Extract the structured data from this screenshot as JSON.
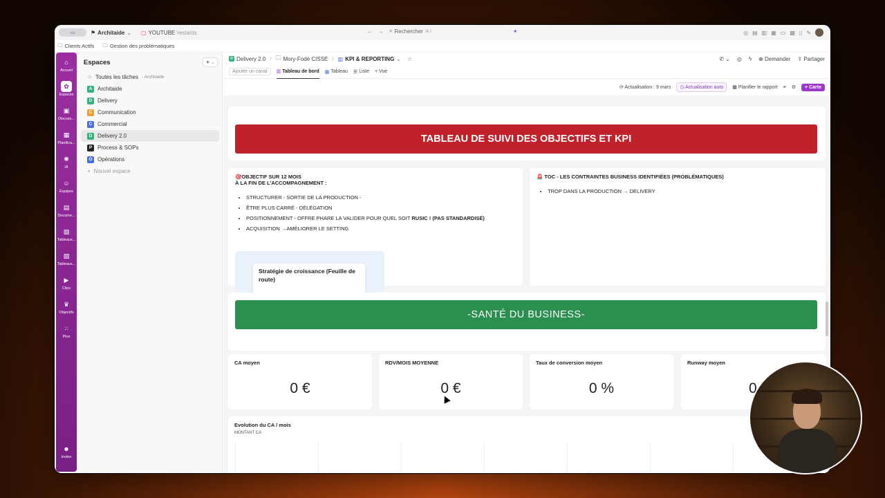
{
  "titlebar": {
    "workspace": "Architaide",
    "tab_label": "YOUTUBE",
    "tab_suffix": "restants",
    "search_placeholder": "Rechercher",
    "search_shortcut": "⌘J"
  },
  "bookmarks": [
    {
      "label": "Clients Actifs"
    },
    {
      "label": "Gestion des problématiques"
    }
  ],
  "rail": [
    {
      "label": "Accueil",
      "icon": "home-icon"
    },
    {
      "label": "Espaces",
      "icon": "spaces-icon",
      "active": true
    },
    {
      "label": "Discuss...",
      "icon": "chat-icon"
    },
    {
      "label": "Planifica...",
      "icon": "calendar-icon"
    },
    {
      "label": "IA",
      "icon": "ai-icon"
    },
    {
      "label": "Équipes",
      "icon": "team-icon"
    },
    {
      "label": "Docume...",
      "icon": "document-icon"
    },
    {
      "label": "Tableaux...",
      "icon": "dashboard-icon"
    },
    {
      "label": "Tableaux...",
      "icon": "whiteboard-icon"
    },
    {
      "label": "Clips",
      "icon": "clip-icon"
    },
    {
      "label": "Objectifs",
      "icon": "trophy-icon"
    },
    {
      "label": "Plus",
      "icon": "grid-icon"
    }
  ],
  "rail_bottom": {
    "label": "Inviter"
  },
  "spaces": {
    "title": "Espaces",
    "all_tasks": "Toutes les tâches",
    "all_tasks_sub": "- Architaide",
    "items": [
      {
        "letter": "A",
        "label": "Architaide",
        "color": "#2fb47c"
      },
      {
        "letter": "D",
        "label": "Delivery",
        "color": "#2fb47c"
      },
      {
        "letter": "C",
        "label": "Communication",
        "color": "#f0a030"
      },
      {
        "letter": "C",
        "label": "Commercial",
        "color": "#4a6ee0"
      },
      {
        "letter": "D",
        "label": "Delivery 2.0",
        "color": "#2fb47c",
        "active": true
      },
      {
        "letter": "P",
        "label": "Process & SOPs",
        "color": "#222222"
      },
      {
        "letter": "O",
        "label": "Opérations",
        "color": "#4a6ee0"
      }
    ],
    "new_space": "Nouvel espace"
  },
  "breadcrumb": {
    "space": "Delivery 2.0",
    "folder": "Mory-Fodé CISSE",
    "page": "KPI & REPORTING"
  },
  "topbar_actions": {
    "ask": "Demander",
    "share": "Partager"
  },
  "views": {
    "add_channel": "Ajouter un canal",
    "tabs": [
      {
        "label": "Tableau de bord",
        "active": true
      },
      {
        "label": "Tableau"
      },
      {
        "label": "Liste"
      },
      {
        "label": "Vue"
      }
    ]
  },
  "actions": {
    "refresh": "Actualisation : 9 mars",
    "auto_refresh": "Actualisation auto",
    "schedule": "Planifier le rapport",
    "add_card": "Carte"
  },
  "dashboard": {
    "banner1": "TABLEAU DE SUIVI DES OBJECTIFS ET KPI",
    "banner1_color": "#c0222c",
    "objective": {
      "title": "🎯OBJECTIF SUR 12 MOIS",
      "subtitle": "À LA FIN DE L'ACCOMPAGNEMENT :",
      "bullets": [
        "STRUCTURER - SORTIE DE LA PRODUCTION -",
        "ÊTRE PLUS CARRÉ - DÉLÉGATION",
        "POSITIONNEMENT - OFFRE PHARE LA VALIDER POUR QUEL SOIT",
        " ACQUISITION →AMÉLIORER LE SETTING"
      ],
      "bullet3_bold": "RUSIC ! (PAS STANDARDISÉ)",
      "doc_title": "Stratégie de croissance (Feuille de route)"
    },
    "toc": {
      "title": "🚨 TOC - LES CONTRAINTES BUSINESS IDENTIFIÉES (PROBLÉMATIQUES)",
      "bullets": [
        "TROP DANS LA PRODUCTION → DELIVERY"
      ]
    },
    "banner2": "-SANTÉ DU BUSINESS-",
    "banner2_color": "#2a8f4f",
    "kpis": [
      {
        "title": "CA moyen",
        "value": "0 €"
      },
      {
        "title": "RDV/MOIS MOYENNE",
        "value": "0 €"
      },
      {
        "title": "Taux de conversion moyen",
        "value": "0 %"
      },
      {
        "title": "Runway moyen",
        "value": "0"
      }
    ],
    "chart": {
      "title": "Evolution du CA / mois",
      "subtitle": "MONTANT CA"
    }
  }
}
